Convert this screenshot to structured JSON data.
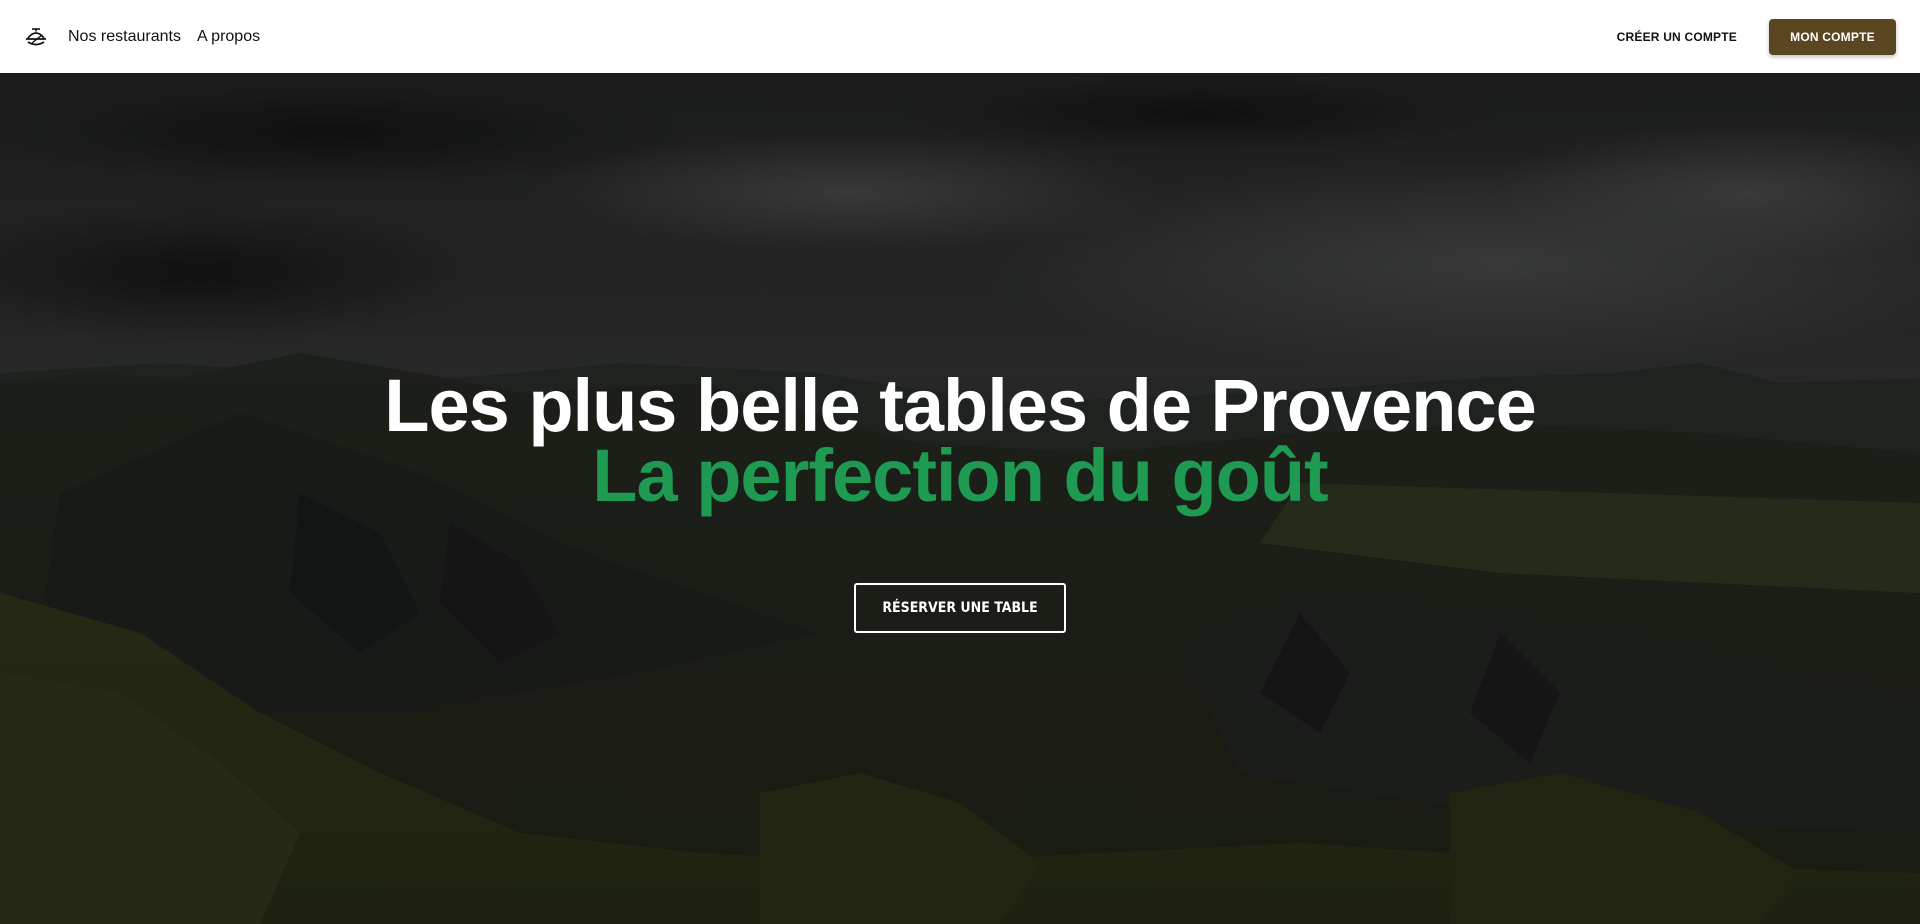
{
  "nav": {
    "logo_icon": "dish-cloche-icon",
    "links": [
      {
        "label": "Nos restaurants"
      },
      {
        "label": "A propos"
      }
    ],
    "create_account_label": "CRÉER UN COMPTE",
    "my_account_label": "MON COMPTE"
  },
  "hero": {
    "title": "Les plus belle tables de Provence",
    "subtitle": "La perfection du goût",
    "cta_label": "RÉSERVER UNE TABLE"
  },
  "colors": {
    "accent_green": "#1f9a53",
    "account_button": "#5a4621",
    "overlay": "#000000"
  }
}
